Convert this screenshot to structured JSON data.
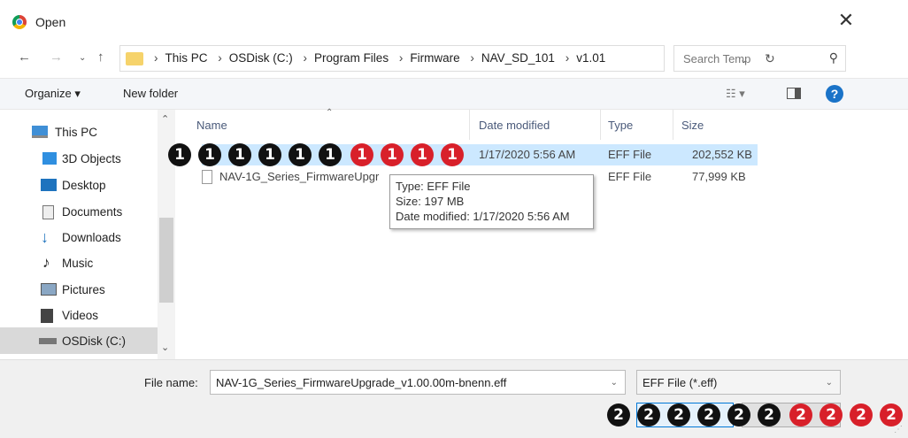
{
  "window": {
    "title": "Open"
  },
  "nav": {
    "path": [
      "This PC",
      "OSDisk (C:)",
      "Program Files",
      "Firmware",
      "NAV_SD_101",
      "v1.01"
    ],
    "search_placeholder": "Search Temp"
  },
  "toolbar": {
    "organize": "Organize ▾",
    "new_folder": "New folder"
  },
  "sidebar": {
    "items": [
      {
        "label": "This PC",
        "icon": "computer-icon"
      },
      {
        "label": "3D Objects",
        "icon": "cube-icon"
      },
      {
        "label": "Desktop",
        "icon": "desktop-icon"
      },
      {
        "label": "Documents",
        "icon": "document-icon"
      },
      {
        "label": "Downloads",
        "icon": "download-icon"
      },
      {
        "label": "Music",
        "icon": "music-icon"
      },
      {
        "label": "Pictures",
        "icon": "picture-icon"
      },
      {
        "label": "Videos",
        "icon": "video-icon"
      },
      {
        "label": "OSDisk (C:)",
        "icon": "drive-icon"
      }
    ]
  },
  "columns": {
    "name": "Name",
    "date": "Date modified",
    "type": "Type",
    "size": "Size"
  },
  "files": [
    {
      "name": "",
      "date": "1/17/2020 5:56 AM",
      "type": "EFF File",
      "size": "202,552 KB"
    },
    {
      "name": "NAV-1G_Series_FirmwareUpgr",
      "date": "",
      "type": "EFF File",
      "size": "77,999 KB"
    }
  ],
  "tooltip": {
    "type": "Type: EFF File",
    "size": "Size: 197 MB",
    "date": "Date modified: 1/17/2020 5:56 AM"
  },
  "bottom": {
    "file_name_label": "File name:",
    "file_name_value": "NAV-1G_Series_FirmwareUpgrade_v1.00.00m-bnenn.eff",
    "file_type": "EFF File (*.eff)"
  },
  "badges": {
    "row1": [
      "1",
      "1",
      "1",
      "1",
      "1",
      "1",
      "1",
      "1",
      "1",
      "1"
    ],
    "row2": [
      "2",
      "2",
      "2",
      "2",
      "2",
      "2",
      "2",
      "2",
      "2",
      "2"
    ],
    "colors": {
      "black": "#111111",
      "red": "#d8202a"
    }
  }
}
